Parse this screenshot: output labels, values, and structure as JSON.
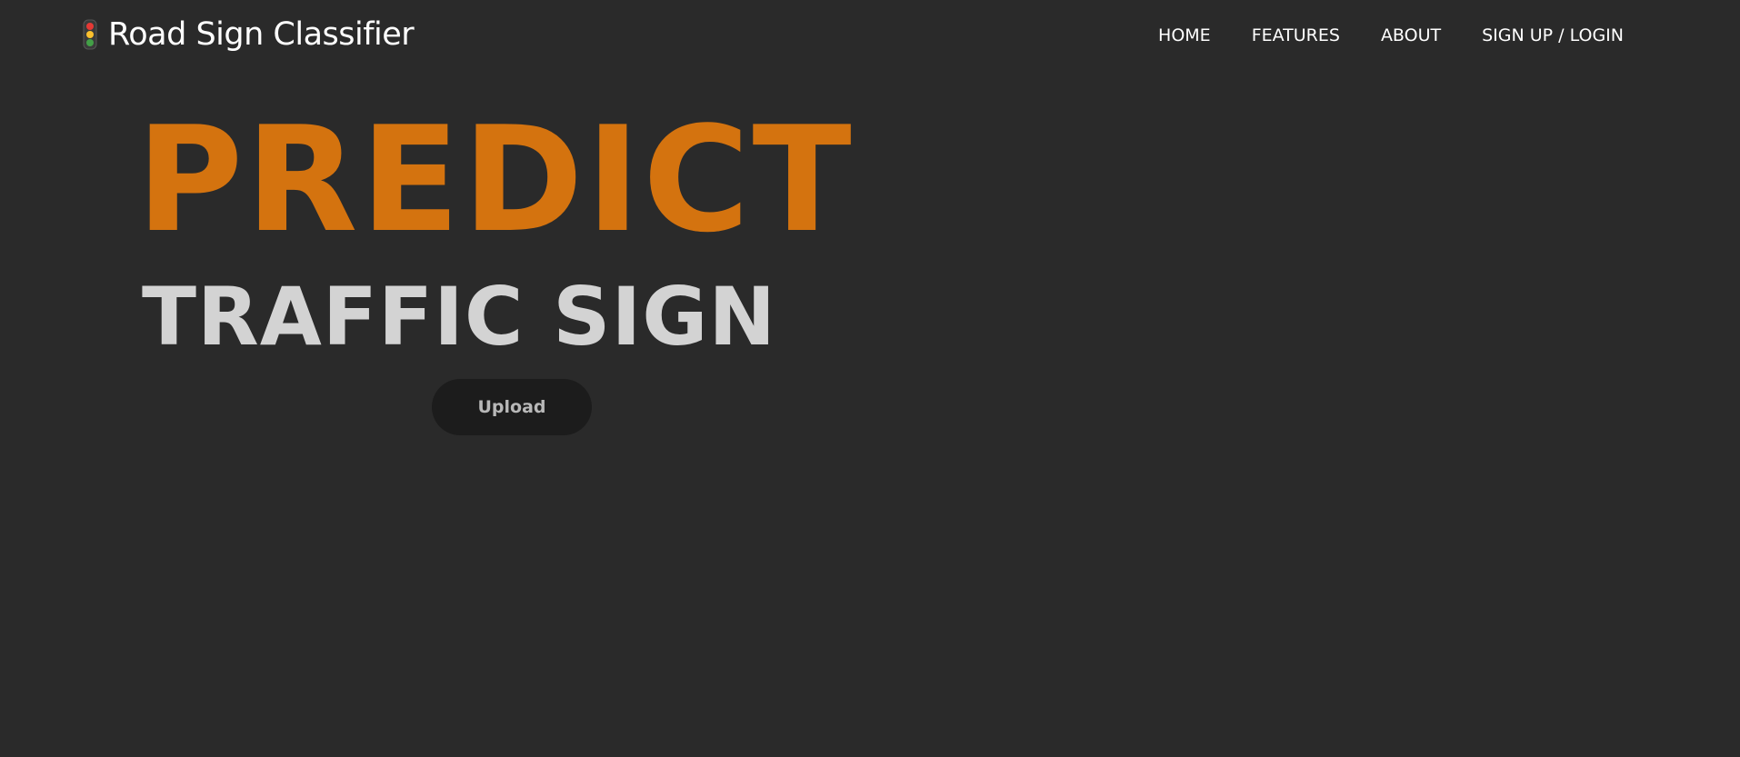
{
  "navbar": {
    "brand": {
      "icon": "traffic-light-icon",
      "title": "Road Sign Classifier"
    },
    "links": [
      {
        "label": "HOME"
      },
      {
        "label": "FEATURES"
      },
      {
        "label": "ABOUT"
      },
      {
        "label": "SIGN UP / LOGIN"
      }
    ]
  },
  "hero": {
    "title": "PREDICT",
    "subtitle": "TRAFFIC SIGN",
    "upload_label": "Upload"
  },
  "colors": {
    "background": "#2a2a2a",
    "accent": "#d4730f",
    "subtitle": "#d3d3d3",
    "button_bg": "#1c1c1c",
    "button_text": "#b8b8b8"
  }
}
